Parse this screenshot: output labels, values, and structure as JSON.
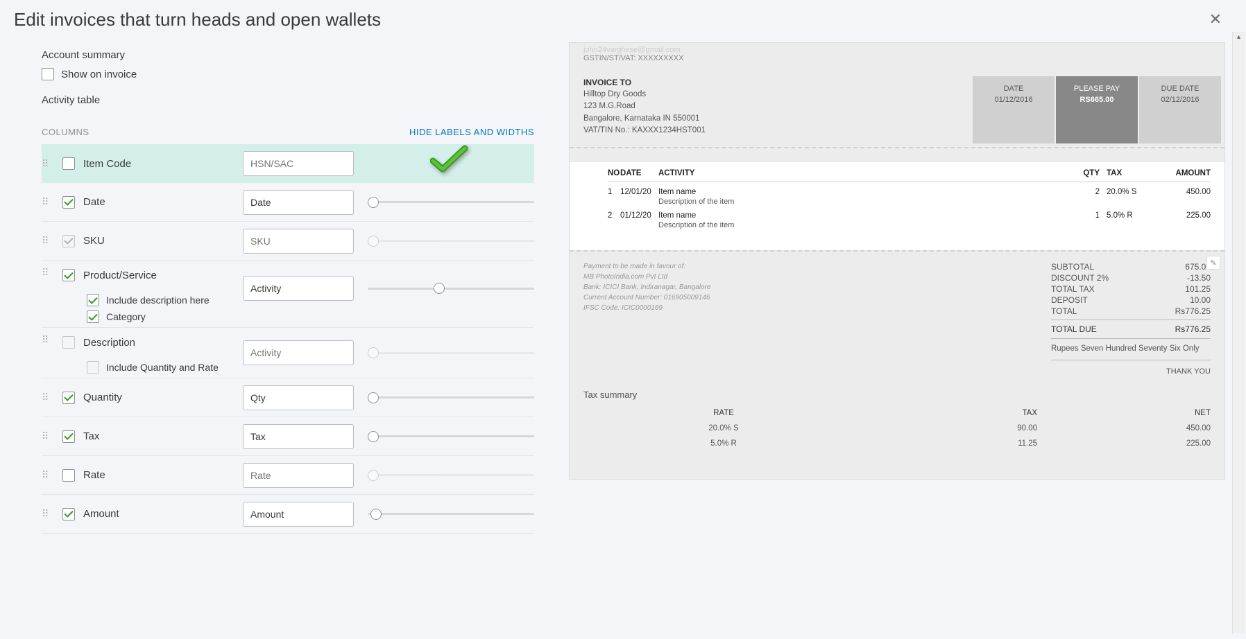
{
  "header": {
    "title": "Edit invoices that turn heads and open wallets"
  },
  "left": {
    "account_summary": "Account summary",
    "show_on_invoice": "Show on invoice",
    "activity_table": "Activity table",
    "columns_label": "COLUMNS",
    "hide_labels": "HIDE LABELS AND WIDTHS",
    "rows": {
      "item_code": {
        "label": "Item Code",
        "placeholder": "HSN/SAC"
      },
      "date": {
        "label": "Date",
        "input": "Date"
      },
      "sku": {
        "label": "SKU",
        "placeholder": "SKU"
      },
      "product": {
        "label": "Product/Service",
        "input": "Activity",
        "sub1": "Include description here",
        "sub2": "Category"
      },
      "description": {
        "label": "Description",
        "placeholder": "Activity",
        "sub1": "Include Quantity and Rate"
      },
      "quantity": {
        "label": "Quantity",
        "input": "Qty"
      },
      "tax": {
        "label": "Tax",
        "input": "Tax"
      },
      "rate": {
        "label": "Rate",
        "placeholder": "Rate"
      },
      "amount": {
        "label": "Amount",
        "input": "Amount"
      }
    }
  },
  "preview": {
    "top_email": "john24varghese@gmail.com",
    "top_gst": "GSTIN/ST/VAT: XXXXXXXXX",
    "invoice_to_label": "INVOICE TO",
    "cust_name": "Hilltop Dry Goods",
    "cust_addr1": "123 M.G.Road",
    "cust_addr2": "Bangalore, Karnataka IN 550001",
    "cust_vat": "VAT/TIN No.: KAXXX1234HST001",
    "box_date_lbl": "DATE",
    "box_date_val": "01/12/2016",
    "box_pay_lbl": "PLEASE PAY",
    "box_pay_val": "RS665.00",
    "box_due_lbl": "DUE DATE",
    "box_due_val": "02/12/2016",
    "li_headers": {
      "no": "NO",
      "date": "DATE",
      "activity": "ACTIVITY",
      "qty": "QTY",
      "tax": "TAX",
      "amount": "AMOUNT"
    },
    "lines": [
      {
        "no": "1",
        "date": "12/01/20",
        "name": "Item name",
        "desc": "Description of the item",
        "qty": "2",
        "tax": "20.0% S",
        "amount": "450.00"
      },
      {
        "no": "2",
        "date": "01/12/20",
        "name": "Item name",
        "desc": "Description of the item",
        "qty": "1",
        "tax": "5.0% R",
        "amount": "225.00"
      }
    ],
    "pay_favour": "Payment to be made in favour of:",
    "pay_name": "MB PhotoIndia.com Pvt Ltd",
    "pay_bank": "Bank: ICICI Bank, Indiranagar, Bangalore",
    "pay_acct": "Current Account Number: 016905009146",
    "pay_ifsc": "IFSC Code: ICIC0000169",
    "totals": {
      "subtotal_lbl": "SUBTOTAL",
      "subtotal_val": "675.00",
      "discount_lbl": "DISCOUNT 2%",
      "discount_val": "-13.50",
      "tax_lbl": "TOTAL TAX",
      "tax_val": "101.25",
      "deposit_lbl": "DEPOSIT",
      "deposit_val": "10.00",
      "total_lbl": "TOTAL",
      "total_val": "Rs776.25",
      "due_lbl": "TOTAL DUE",
      "due_val": "Rs776.25",
      "words": "Rupees Seven Hundred Seventy Six Only",
      "thanks": "THANK YOU"
    },
    "tax_summary_title": "Tax summary",
    "ts_headers": {
      "rate": "RATE",
      "tax": "TAX",
      "net": "NET"
    },
    "ts_rows": [
      {
        "rate": "20.0% S",
        "tax": "90.00",
        "net": "450.00"
      },
      {
        "rate": "5.0% R",
        "tax": "11.25",
        "net": "225.00"
      }
    ]
  }
}
